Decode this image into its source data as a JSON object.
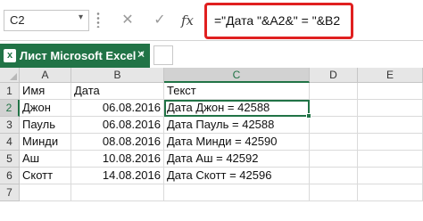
{
  "formula_bar": {
    "name_box": "C2",
    "cancel_icon": "✕",
    "enter_icon": "✓",
    "fx_label": "fx",
    "formula": "=\"Дата \"&A2&\" = \"&B2",
    "highlight_color": "#e02020"
  },
  "workbook_tab": {
    "title": "Лист Microsoft Excel *",
    "close_icon": "✕",
    "icon_letter": "x",
    "accent_color": "#217346"
  },
  "grid": {
    "columns": [
      "A",
      "B",
      "C",
      "D",
      "E"
    ],
    "rows": [
      "1",
      "2",
      "3",
      "4",
      "5",
      "6",
      "7"
    ],
    "active_cell": "C2",
    "headers": [
      "Имя",
      "Дата",
      "Текст"
    ],
    "data": [
      {
        "name": "Джон",
        "date": "06.08.2016",
        "text": "Дата Джон = 42588"
      },
      {
        "name": "Пауль",
        "date": "06.08.2016",
        "text": "Дата Пауль = 42588"
      },
      {
        "name": "Минди",
        "date": "08.08.2016",
        "text": "Дата Минди = 42590"
      },
      {
        "name": "Аш",
        "date": "10.08.2016",
        "text": "Дата Аш = 42592"
      },
      {
        "name": "Скотт",
        "date": "14.08.2016",
        "text": "Дата Скотт = 42596"
      }
    ]
  }
}
